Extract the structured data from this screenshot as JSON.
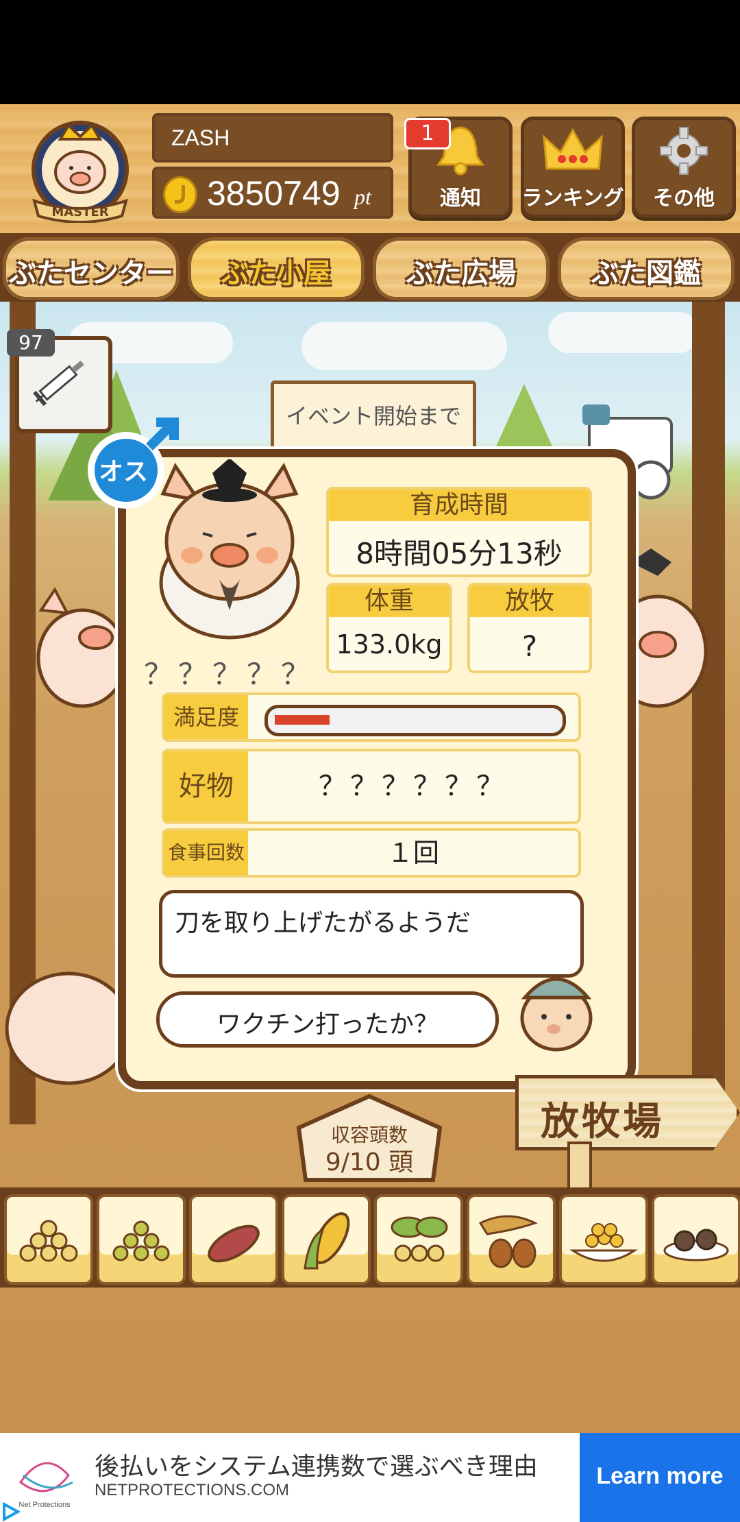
{
  "header": {
    "player_name": "ZASH",
    "points": "3850749",
    "points_unit": "pt",
    "master_label": "MASTER",
    "buttons": [
      {
        "label": "通知",
        "icon": "bell-icon",
        "badge": "1"
      },
      {
        "label": "ランキング",
        "icon": "crown-icon"
      },
      {
        "label": "その他",
        "icon": "gear-icon"
      }
    ]
  },
  "tabs": [
    {
      "label": "ぶたセンター",
      "active": false
    },
    {
      "label": "ぶた小屋",
      "active": true
    },
    {
      "label": "ぶた広場",
      "active": false
    },
    {
      "label": "ぶた図鑑",
      "active": false
    }
  ],
  "item": {
    "count": "97",
    "icon": "syringe-icon"
  },
  "event_sign": {
    "text": "イベント開始まで"
  },
  "pig": {
    "gender_label": "オス",
    "name": "？？？？？",
    "stats": {
      "raising_time_label": "育成時間",
      "raising_time_value": "8時間05分13秒",
      "weight_label": "体重",
      "weight_value": "133.0kg",
      "grazing_label": "放牧",
      "grazing_value": "?"
    },
    "satisfaction_label": "満足度",
    "satisfaction_level": 0.2,
    "favorite_label": "好物",
    "favorite_value": "？？？？？？",
    "meals_label": "食事回数",
    "meals_value": "１回",
    "message": "刀を取り上げたがるようだ",
    "farmer_speech": "ワクチン打ったか？"
  },
  "barn": {
    "label": "収容頭数",
    "value": "9/10 頭"
  },
  "ranch_sign": "放牧場",
  "foods": [
    "beans-icon",
    "green-beans-icon",
    "sweet-potato-icon",
    "corn-icon",
    "vegetables-icon",
    "acorn-icon",
    "soybeans-icon",
    "chestnut-plate-icon"
  ],
  "ad": {
    "title": "後払いをシステム連携数で選ぶべき理由",
    "domain": "NETPROTECTIONS.COM",
    "logo_caption": "Net Protections",
    "cta": "Learn more"
  },
  "colors": {
    "wood": "#6b3f1c",
    "accent": "#f8cc3f",
    "ad_blue": "#1a73e8",
    "satisfaction_bar": "#d9432a"
  }
}
